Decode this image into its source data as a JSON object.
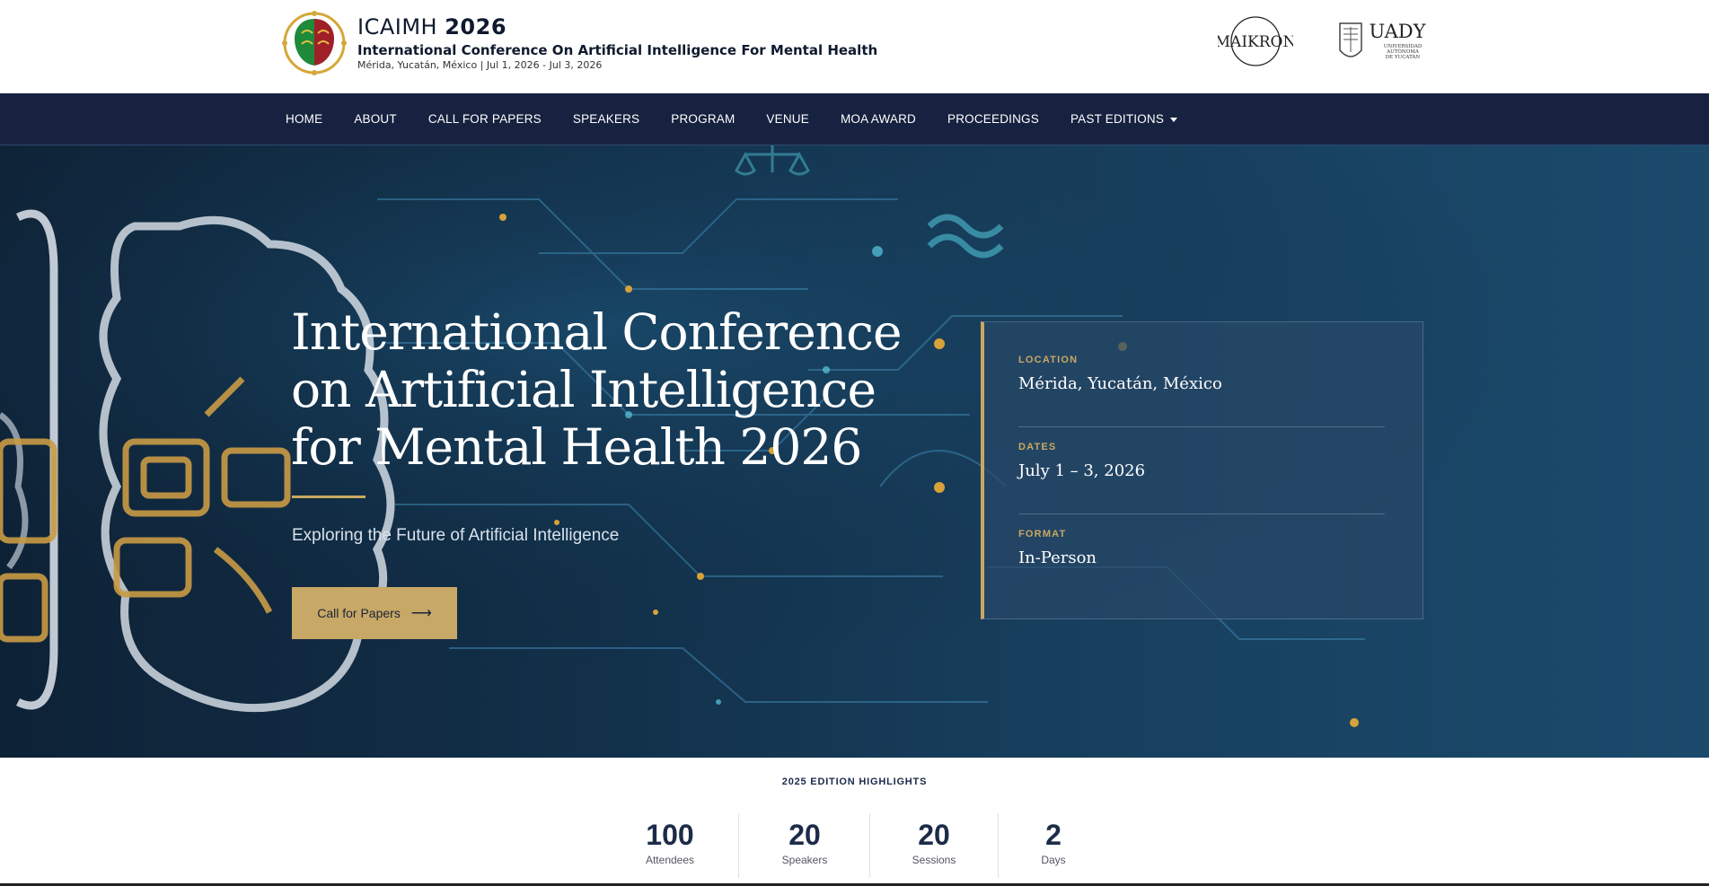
{
  "header": {
    "brand_name": "ICAIMH",
    "brand_year": "2026",
    "brand_subtitle": "International Conference On Artificial Intelligence For Mental Health",
    "brand_meta": "Mérida, Yucatán, México | Jul 1, 2026 - Jul 3, 2026",
    "partner1_name": "MAIKRON",
    "partner2_name": "UADY",
    "partner2_caption_1": "UNIVERSIDAD",
    "partner2_caption_2": "AUTÓNOMA",
    "partner2_caption_3": "DE YUCATÁN"
  },
  "nav": {
    "items": [
      {
        "label": "HOME"
      },
      {
        "label": "ABOUT"
      },
      {
        "label": "CALL FOR PAPERS"
      },
      {
        "label": "SPEAKERS"
      },
      {
        "label": "PROGRAM"
      },
      {
        "label": "VENUE"
      },
      {
        "label": "MOA AWARD"
      },
      {
        "label": "PROCEEDINGS"
      },
      {
        "label": "PAST EDITIONS"
      }
    ]
  },
  "hero": {
    "title": "International Conference on Artificial Intelligence for Mental Health 2026",
    "subtitle": "Exploring the Future of Artificial Intelligence",
    "cta_label": "Call for Papers",
    "cta_arrow": "⟶",
    "info": [
      {
        "label": "LOCATION",
        "value": "Mérida, Yucatán, México"
      },
      {
        "label": "DATES",
        "value": "July 1 – 3, 2026"
      },
      {
        "label": "FORMAT",
        "value": "In-Person"
      }
    ]
  },
  "highlights": {
    "title": "2025 EDITION HIGHLIGHTS",
    "stats": [
      {
        "value": "100",
        "label": "Attendees"
      },
      {
        "value": "20",
        "label": "Speakers"
      },
      {
        "value": "20",
        "label": "Sessions"
      },
      {
        "value": "2",
        "label": "Days"
      }
    ]
  },
  "colors": {
    "nav_bg": "#16223f",
    "accent_gold": "#c9a861",
    "hero_bg": "#12304a"
  }
}
